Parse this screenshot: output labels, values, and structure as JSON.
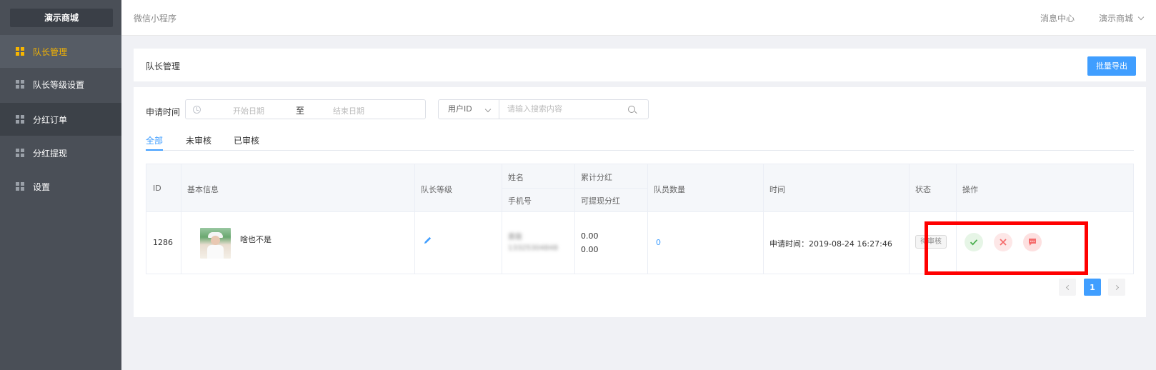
{
  "sidebar": {
    "brand": "演示商城",
    "items": [
      {
        "label": "队长管理",
        "icon": "grid-icon"
      },
      {
        "label": "队长等级设置",
        "icon": "grid-icon"
      },
      {
        "label": "分红订单",
        "icon": "grid-icon"
      },
      {
        "label": "分红提现",
        "icon": "grid-icon"
      },
      {
        "label": "设置",
        "icon": "grid-icon"
      }
    ]
  },
  "topbar": {
    "title": "微信小程序",
    "message_center": "消息中心",
    "shop": "演示商城"
  },
  "header": {
    "title": "队长管理",
    "export_label": "批量导出"
  },
  "filters": {
    "apply_time_label": "申请时间",
    "start_placeholder": "开始日期",
    "range_separator": "至",
    "end_placeholder": "结束日期",
    "search_type": "用户ID",
    "search_placeholder": "请输入搜索内容"
  },
  "tabs": [
    "全部",
    "未审核",
    "已审核"
  ],
  "table": {
    "headers": {
      "id": "ID",
      "basic_info": "基本信息",
      "level": "队长等级",
      "name": "姓名",
      "phone": "手机号",
      "total_bonus": "累计分红",
      "withdrawable_bonus": "可提现分红",
      "member_count": "队员数量",
      "time": "时间",
      "status": "状态",
      "actions": "操作"
    },
    "rows": [
      {
        "id": "1286",
        "nickname": "啥也不是",
        "name": "黄筱",
        "phone": "13325304848",
        "total_bonus": "0.00",
        "withdrawable_bonus": "0.00",
        "member_count": "0",
        "time": "申请时间：2019-08-24 16:27:46",
        "status": "待审核"
      }
    ]
  },
  "pagination": {
    "current_page": "1"
  },
  "colors": {
    "sidebar_bg": "#4a4f57",
    "active_nav": "#f7b500",
    "primary": "#409eff",
    "highlight": "#ff0000"
  }
}
